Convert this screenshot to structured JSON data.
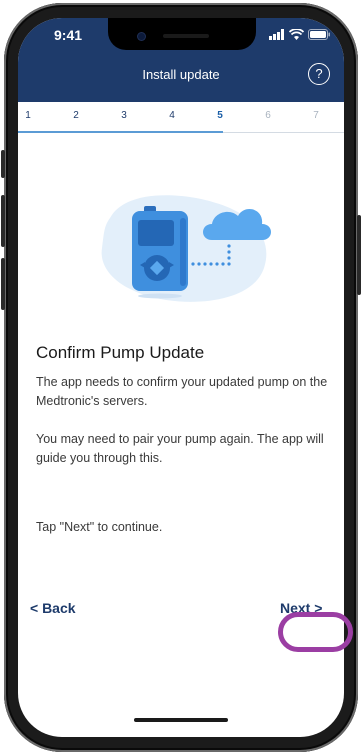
{
  "status": {
    "time": "9:41"
  },
  "header": {
    "title": "Install update",
    "help_glyph": "?"
  },
  "stepper": {
    "steps": [
      "1",
      "2",
      "3",
      "4",
      "5",
      "6",
      "7"
    ],
    "current_step": 5
  },
  "content": {
    "title": "Confirm Pump Update",
    "paragraphs": [
      "The app needs to confirm your updated pump on the Medtronic's servers.",
      "You may need to pair your pump again. The app will guide you through this.",
      "Tap \"Next\" to continue."
    ]
  },
  "navigation": {
    "back_label": "< Back",
    "next_label": "Next >"
  },
  "colors": {
    "header_bg": "#1e3b6b",
    "accent": "#1b5fa8",
    "highlight": "#9b3ea3"
  },
  "icons": [
    "question-icon",
    "pump-icon",
    "cloud-icon",
    "signal-icon",
    "wifi-icon",
    "battery-icon"
  ]
}
